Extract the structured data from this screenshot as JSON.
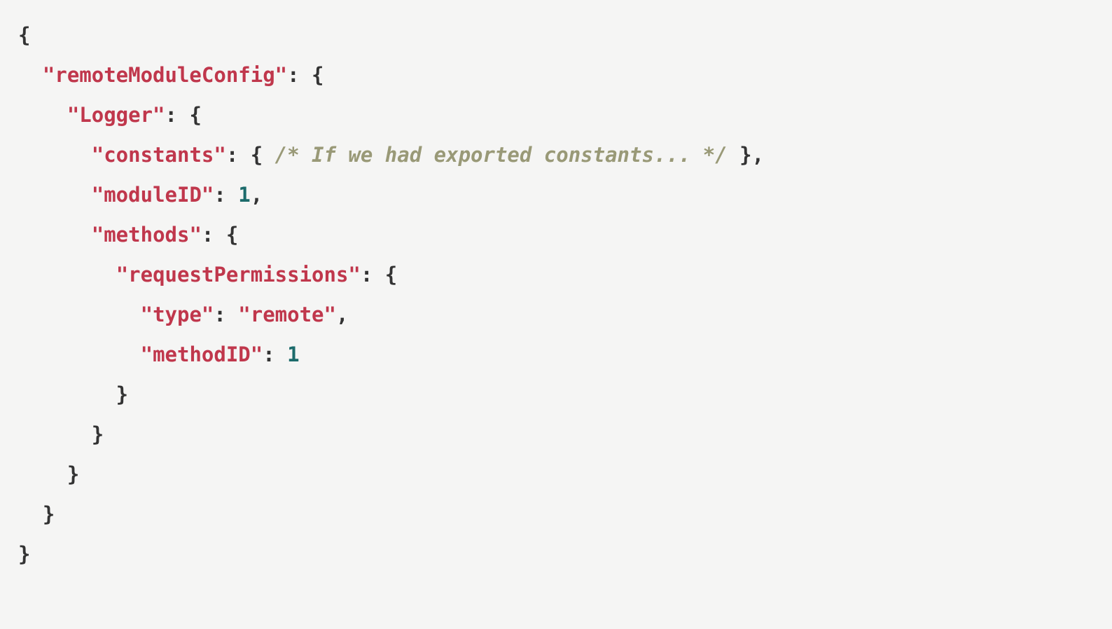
{
  "lines": {
    "l1": {
      "p1": "{"
    },
    "l2": {
      "p1": "  ",
      "k1": "\"remoteModuleConfig\"",
      "p2": ": {"
    },
    "l3": {
      "p1": "    ",
      "k1": "\"Logger\"",
      "p2": ": {"
    },
    "l4": {
      "p1": "      ",
      "k1": "\"constants\"",
      "p2": ": { ",
      "c1": "/* If we had exported constants... */",
      "p3": " },"
    },
    "l5": {
      "p1": "      ",
      "k1": "\"moduleID\"",
      "p2": ": ",
      "n1": "1",
      "p3": ","
    },
    "l6": {
      "p1": "      ",
      "k1": "\"methods\"",
      "p2": ": {"
    },
    "l7": {
      "p1": "        ",
      "k1": "\"requestPermissions\"",
      "p2": ": {"
    },
    "l8": {
      "p1": "          ",
      "k1": "\"type\"",
      "p2": ": ",
      "s1": "\"remote\"",
      "p3": ","
    },
    "l9": {
      "p1": "          ",
      "k1": "\"methodID\"",
      "p2": ": ",
      "n1": "1"
    },
    "l10": {
      "p1": "        }"
    },
    "l11": {
      "p1": "      }"
    },
    "l12": {
      "p1": "    }"
    },
    "l13": {
      "p1": "  }"
    },
    "l14": {
      "p1": "}"
    }
  }
}
